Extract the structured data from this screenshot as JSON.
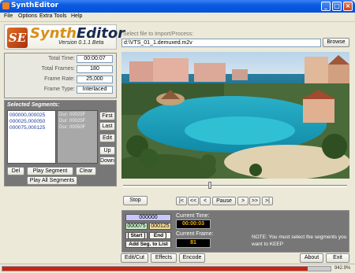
{
  "window": {
    "title": "SynthEditor"
  },
  "menu": [
    "File",
    "Options",
    "Extra Tools",
    "Help"
  ],
  "logo": {
    "synth": "Synth",
    "editor": "Editor",
    "version": "Version 0.1.1 Beta",
    "mark": "SE"
  },
  "file": {
    "label": "Select file to Import/Process:",
    "path": "d:\\VTS_01_1.demuxed.m2v",
    "browse": "Browse"
  },
  "info": {
    "total_time_label": "Total Time:",
    "total_time": "00:00:07",
    "total_frames_label": "Total Frames:",
    "total_frames": "180",
    "frame_rate_label": "Frame Rate:",
    "frame_rate": "25,000",
    "frame_type_label": "Frame Type:",
    "frame_type": "Interlaced"
  },
  "segments": {
    "title": "Selected Segments:",
    "items": [
      "000000,000025",
      "000025,000050",
      "000075,000125"
    ],
    "durations": [
      "Dur: 00025F",
      "Dur: 00025F",
      "Dur: 00050F"
    ],
    "first": "First",
    "last": "Last",
    "edit": "Edit",
    "up": "Up",
    "down": "Down",
    "del": "Del",
    "play_segment": "Play Segment",
    "clear": "Clear",
    "play_all": "Play All Segments"
  },
  "transport": {
    "stop": "Stop",
    "b1": "|<",
    "b2": "<<",
    "b3": "<",
    "pause": "Pause",
    "b4": ">",
    "b5": ">>",
    "b6": ">|"
  },
  "timecode": {
    "current": "000000",
    "start_val": "000075",
    "end_val": "000125",
    "start": "[ Start ]",
    "end": "End ]",
    "add": "Add Seg. to List",
    "current_time_label": "Current Time:",
    "current_time": "00:00:03",
    "current_frame_label": "Current Frame:",
    "current_frame": "81",
    "note": "NOTE: You must select the segments you want to KEEP"
  },
  "bottom": {
    "editcut": "Edit/Cut",
    "effects": "Effects",
    "encode": "Encode",
    "about": "About",
    "exit": "Exit"
  },
  "status": {
    "percent": "942.9%",
    "progress": 0.93,
    "progress_color": "#d02010"
  }
}
